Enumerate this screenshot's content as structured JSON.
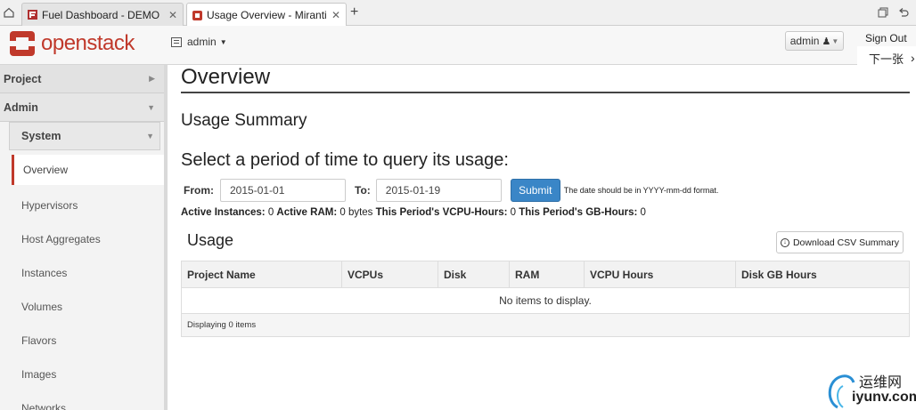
{
  "browser": {
    "tabs": [
      {
        "label": "Fuel Dashboard - DEMO",
        "favicon": "fuel-icon",
        "active": false
      },
      {
        "label": "Usage Overview - Mirantis O",
        "favicon": "openstack-icon",
        "active": true
      }
    ],
    "new_tab_label": "+"
  },
  "header": {
    "brand": "openstack",
    "project_label": "admin",
    "user_label": "admin",
    "sign_out": "Sign Out",
    "next_page": "下一张"
  },
  "sidebar": {
    "project_label": "Project",
    "admin_label": "Admin",
    "system_label": "System",
    "items": [
      "Overview",
      "Hypervisors",
      "Host Aggregates",
      "Instances",
      "Volumes",
      "Flavors",
      "Images",
      "Networks"
    ],
    "active_item": "Overview"
  },
  "main": {
    "title": "Overview",
    "usage_summary": "Usage Summary",
    "select_heading": "Select a period of time to query its usage:",
    "from_label": "From:",
    "from_value": "2015-01-01",
    "to_label": "To:",
    "to_value": "2015-01-19",
    "submit_label": "Submit",
    "hint": "The date should be in YYYY-mm-dd format.",
    "stats": {
      "instances_label": "Active Instances:",
      "instances_value": "0",
      "ram_label": "Active RAM:",
      "ram_value": "0 bytes",
      "vcpu_label": "This Period's VCPU-Hours:",
      "vcpu_value": "0",
      "gb_label": "This Period's GB-Hours:",
      "gb_value": "0"
    },
    "usage_heading": "Usage",
    "csv_button": "Download CSV Summary",
    "table": {
      "columns": [
        "Project Name",
        "VCPUs",
        "Disk",
        "RAM",
        "VCPU Hours",
        "Disk GB Hours"
      ],
      "empty_message": "No items to display.",
      "footer": "Displaying 0 items"
    }
  },
  "watermark": {
    "text": "运维网",
    "url_text": "iyunv.com"
  },
  "colors": {
    "brand_red": "#c0392b",
    "primary_blue": "#3a86c7"
  }
}
